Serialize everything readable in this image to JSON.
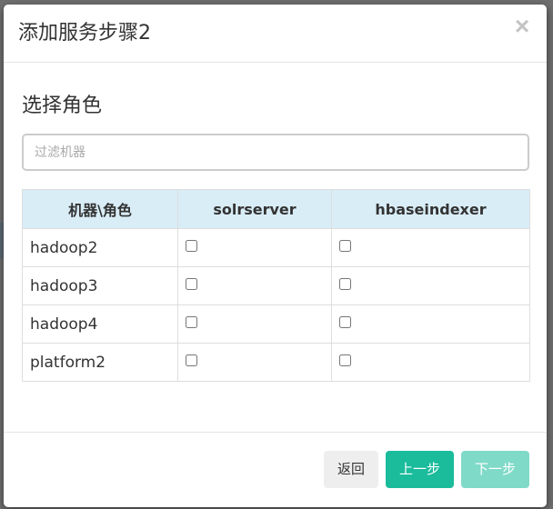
{
  "dialog": {
    "title": "添加服务步骤2",
    "close_glyph": "×"
  },
  "section": {
    "title": "选择角色"
  },
  "filter": {
    "value": "",
    "placeholder": "过滤机器"
  },
  "table": {
    "headers": [
      "机器\\角色",
      "solrserver",
      "hbaseindexer"
    ],
    "rows": [
      {
        "host": "hadoop2",
        "solrserver": false,
        "hbaseindexer": false
      },
      {
        "host": "hadoop3",
        "solrserver": false,
        "hbaseindexer": false
      },
      {
        "host": "hadoop4",
        "solrserver": false,
        "hbaseindexer": false
      },
      {
        "host": "platform2",
        "solrserver": false,
        "hbaseindexer": false
      }
    ]
  },
  "footer": {
    "back_label": "返回",
    "prev_label": "上一步",
    "next_label": "下一步"
  },
  "colors": {
    "primary": "#1abc9c",
    "header_bg": "#d9edf7",
    "default_btn": "#eeeeee"
  }
}
